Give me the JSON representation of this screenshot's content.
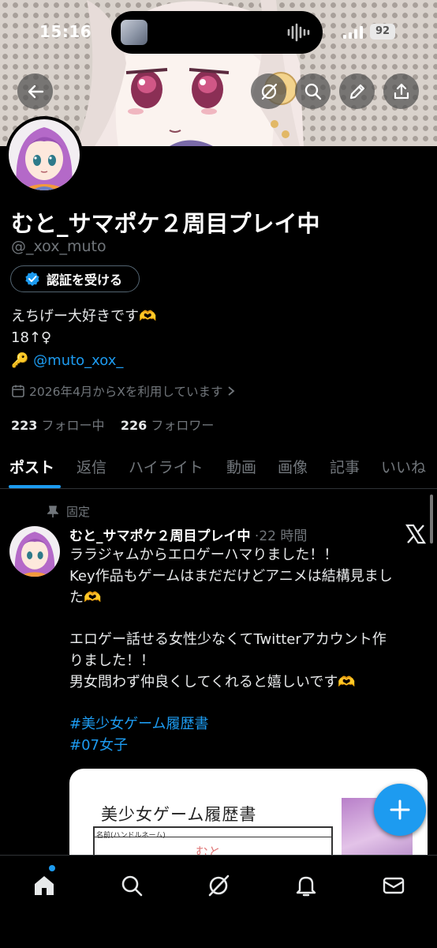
{
  "status_bar": {
    "time": "15:16",
    "battery": "92"
  },
  "profile": {
    "display_name": "むと_サマポケ２周目プレイ中",
    "handle": "@_xox_muto",
    "verify_label": "認証を受ける",
    "bio_line1": "えちげー大好きです🫶",
    "bio_line2": "18↑♀",
    "bio_key": "🔑",
    "bio_link": "@muto_xox_",
    "joined": "2026年4月からXを利用しています",
    "following_count": "223",
    "following_label": "フォロー中",
    "followers_count": "226",
    "followers_label": "フォロワー"
  },
  "tabs": [
    "ポスト",
    "返信",
    "ハイライト",
    "動画",
    "画像",
    "記事",
    "いいね"
  ],
  "post": {
    "pinned_label": "固定",
    "author": "むと_サマポケ２周目プレイ中",
    "time": "22 時間",
    "lines": [
      "ララジャムからエロゲーハマりました！！",
      "Key作品もゲームはまだだけどアニメは結構見まし",
      "た🫶",
      "",
      "エロゲー話せる女性少なくてTwitterアカウント作",
      "りました！！",
      "男女問わず仲良くしてくれると嬉しいです🫶",
      ""
    ],
    "hashtags": [
      "#美少女ゲーム履歴書",
      "#07女子"
    ],
    "card_title": "美少女ゲーム履歴書",
    "card_form_label": "名前(ハンドルネーム)",
    "card_signature": "むと"
  },
  "colors": {
    "accent": "#1d9bf0",
    "muted": "#71767b",
    "background": "#000000"
  },
  "icons": {
    "header": [
      "back-arrow-icon",
      "grok-icon",
      "search-icon",
      "edit-icon",
      "share-icon"
    ],
    "nav": [
      "home-icon",
      "search-icon",
      "grok-icon",
      "notifications-icon",
      "messages-icon"
    ]
  }
}
